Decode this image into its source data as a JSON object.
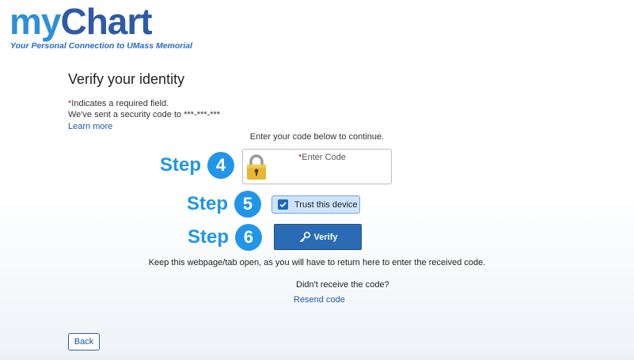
{
  "logo": {
    "my": "my",
    "chart": "Chart",
    "tagline": "Your Personal Connection to UMass Memorial"
  },
  "page": {
    "title": "Verify your identity",
    "required_star": "*",
    "required_note": "Indicates a required field.",
    "sent_note": "We've sent a security code to ***-***-***",
    "learn_more": "Learn more",
    "enter_instructions": "Enter your code below to continue."
  },
  "steps": {
    "word": "Step",
    "step4": "4",
    "step5": "5",
    "step6": "6"
  },
  "code_field": {
    "required_star": "*",
    "label": "Enter Code",
    "value": ""
  },
  "trust": {
    "label": "Trust this device",
    "checked": true
  },
  "verify": {
    "label": "Verify",
    "icon": "key-icon"
  },
  "messages": {
    "keep_open": "Keep this webpage/tab open, as you will have to return here to enter the received code.",
    "didnt_receive": "Didn't receive the code?",
    "resend": "Resend code"
  },
  "back": {
    "label": "Back"
  },
  "colors": {
    "brand_blue": "#2e5aa6",
    "step_blue": "#2196e8",
    "button_blue": "#2b6bb5",
    "required_red": "#c0152f",
    "lock_gold": "#e8b731"
  }
}
